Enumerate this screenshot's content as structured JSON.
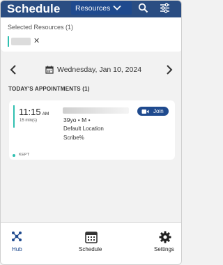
{
  "header": {
    "title": "Schedule",
    "resources_label": "Resources",
    "icons": [
      "chevron-down-icon",
      "search-icon",
      "filter-sliders-icon"
    ]
  },
  "selected_resources": {
    "title": "Selected Resources (1)",
    "chip_remove": "✕"
  },
  "date_nav": {
    "date": "Wednesday, Jan 10, 2024"
  },
  "appointments": {
    "heading": "TODAY'S APPOINTMENTS (1)",
    "items": [
      {
        "time": "11:15",
        "ampm": "AM",
        "duration": "15 min(s)",
        "demographics": "39yo • M •",
        "location": "Default Location",
        "scribe": "Scribe%",
        "join_label": "Join",
        "status": "KEPT"
      }
    ]
  },
  "bottom_nav": {
    "tabs": [
      {
        "label": "Hub",
        "icon": "hub-icon"
      },
      {
        "label": "Schedule",
        "icon": "calendar-icon"
      },
      {
        "label": "Settings",
        "icon": "gear-icon"
      }
    ]
  },
  "colors": {
    "header": "#2a4d82",
    "button": "#1f4a8e",
    "accent": "#2fbfb0",
    "hub_active": "#1f4a8e"
  }
}
